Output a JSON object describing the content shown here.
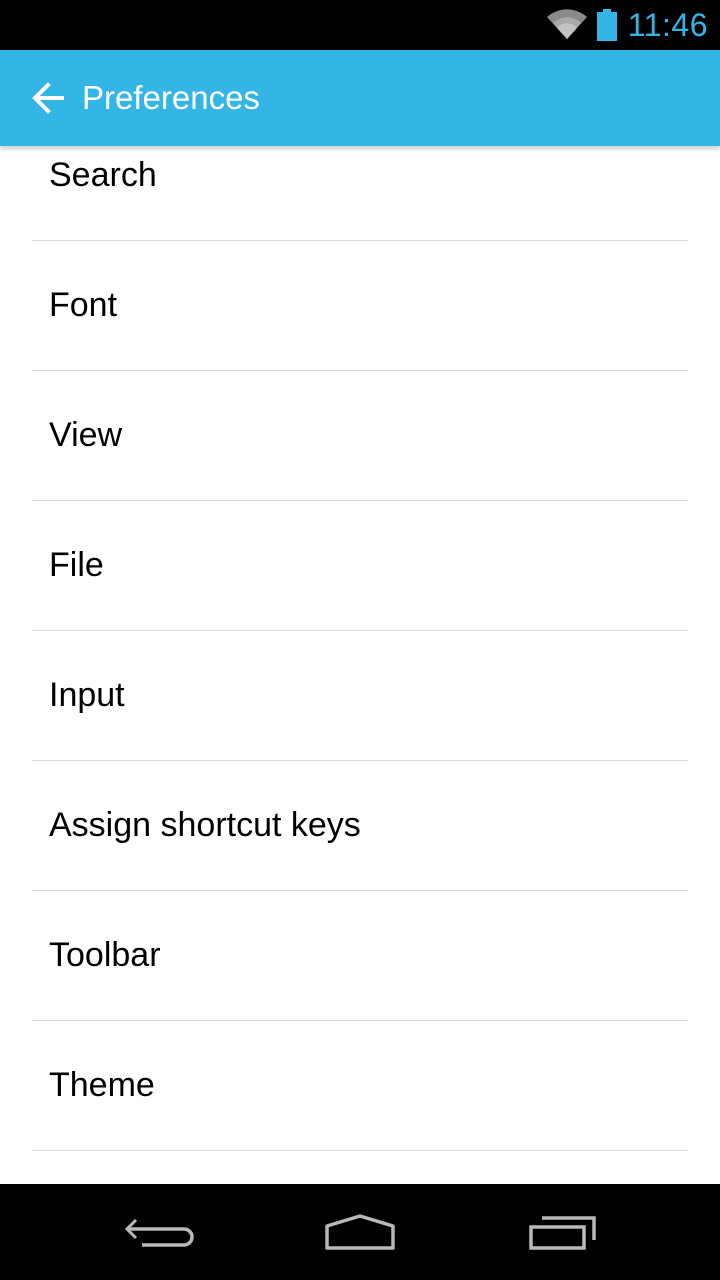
{
  "status_bar": {
    "time": "11:46",
    "icons": [
      "wifi-icon",
      "battery-icon"
    ],
    "accent_color": "#33b5e5"
  },
  "action_bar": {
    "title": "Preferences",
    "back_icon": "arrow-left-icon",
    "color": "#33b5e5"
  },
  "preferences": {
    "items": [
      {
        "label": "Search"
      },
      {
        "label": "Font"
      },
      {
        "label": "View"
      },
      {
        "label": "File"
      },
      {
        "label": "Input"
      },
      {
        "label": "Assign shortcut keys"
      },
      {
        "label": "Toolbar"
      },
      {
        "label": "Theme"
      }
    ]
  },
  "nav_bar": {
    "icons": [
      "back-nav-icon",
      "home-nav-icon",
      "recent-apps-icon"
    ]
  }
}
